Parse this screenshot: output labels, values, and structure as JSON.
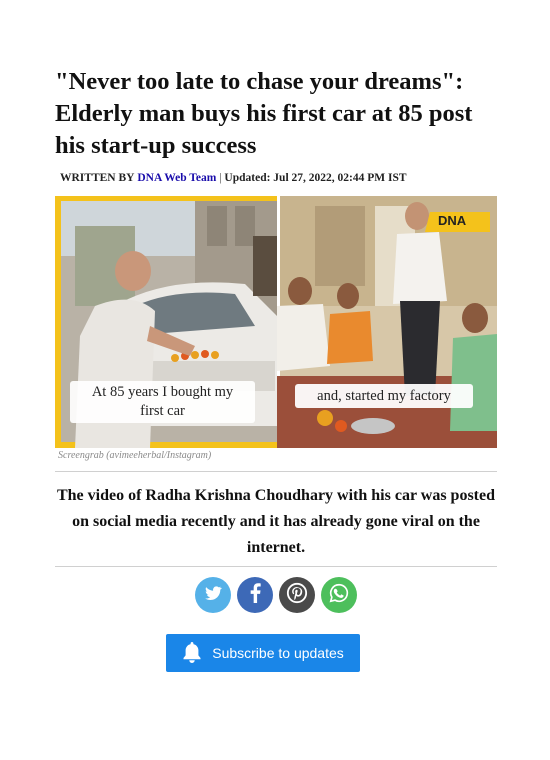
{
  "article": {
    "headline": "\"Never too late to chase your dreams\": Elderly man buys his first car at 85 post his start-up success",
    "byline_label": "WRITTEN BY",
    "author": "DNA Web Team",
    "separator": "|",
    "updated": "Updated: Jul 27, 2022, 02:44 PM IST",
    "image": {
      "overlay_left_line1": "At 85 years I bought my",
      "overlay_left_line2": "first car",
      "overlay_right": "and, started my factory",
      "badge": "DNA",
      "credit": "Screengrab (avimeeherbal/Instagram)"
    },
    "summary": "The video of Radha Krishna Choudhary with his car was posted on social media recently and it has already gone viral on the internet."
  },
  "share": {
    "icons": [
      "twitter-icon",
      "facebook-icon",
      "pinterest-icon",
      "whatsapp-icon"
    ],
    "colors": {
      "twitter": "#55b1e8",
      "facebook": "#3d69b7",
      "pinterest": "#4a4a4a",
      "whatsapp": "#4dbf5c"
    }
  },
  "subscribe": {
    "label": "Subscribe to updates",
    "color": "#1a86e8"
  }
}
